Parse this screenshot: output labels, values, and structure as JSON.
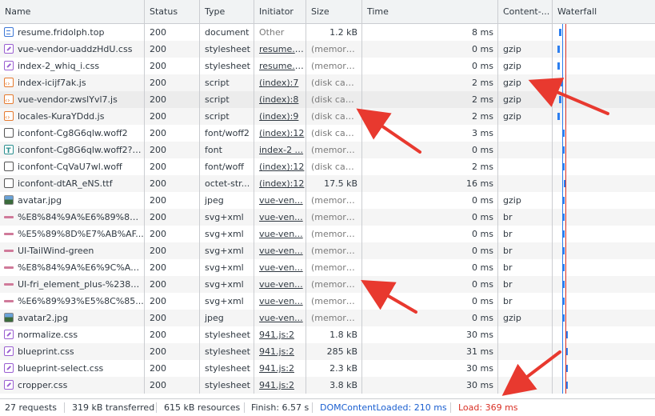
{
  "columns": {
    "name": "Name",
    "status": "Status",
    "type": "Type",
    "initiator": "Initiator",
    "size": "Size",
    "time": "Time",
    "content_encoding": "Content-...",
    "waterfall": "Waterfall"
  },
  "requests": [
    {
      "icon": "document-icon",
      "name": "resume.fridolph.top",
      "status": "200",
      "type": "document",
      "initiator": "Other",
      "size": "1.2 kB",
      "time": "8 ms",
      "encoding": ""
    },
    {
      "icon": "stylesheet-icon",
      "name": "vue-vendor-uaddzHdU.css",
      "status": "200",
      "type": "stylesheet",
      "initiator": "resume.f...",
      "size": "(memory ...",
      "time": "0 ms",
      "encoding": "gzip"
    },
    {
      "icon": "stylesheet-icon",
      "name": "index-2_whiq_i.css",
      "status": "200",
      "type": "stylesheet",
      "initiator": "resume.f...",
      "size": "(memory ...",
      "time": "0 ms",
      "encoding": "gzip"
    },
    {
      "icon": "script-icon",
      "name": "index-icijf7ak.js",
      "status": "200",
      "type": "script",
      "initiator": "(index):7",
      "size": "(disk cac...",
      "time": "2 ms",
      "encoding": "gzip"
    },
    {
      "icon": "script-icon",
      "name": "vue-vendor-zwslYvl7.js",
      "status": "200",
      "type": "script",
      "initiator": "(index):8",
      "size": "(disk cac...",
      "time": "2 ms",
      "encoding": "gzip"
    },
    {
      "icon": "script-icon",
      "name": "locales-KuraYDdd.js",
      "status": "200",
      "type": "script",
      "initiator": "(index):9",
      "size": "(disk cac...",
      "time": "2 ms",
      "encoding": "gzip"
    },
    {
      "icon": "font-file-icon",
      "name": "iconfont-Cg8G6qlw.woff2",
      "status": "200",
      "type": "font/woff2",
      "initiator": "(index):12",
      "size": "(disk cac...",
      "time": "3 ms",
      "encoding": ""
    },
    {
      "icon": "font-icon",
      "name": "iconfont-Cg8G6qlw.woff2?t...",
      "status": "200",
      "type": "font",
      "initiator": "index-2 ...",
      "size": "(memory ...",
      "time": "0 ms",
      "encoding": ""
    },
    {
      "icon": "font-file-icon",
      "name": "iconfont-CqVaU7wl.woff",
      "status": "200",
      "type": "font/woff",
      "initiator": "(index):12",
      "size": "(disk cac...",
      "time": "2 ms",
      "encoding": ""
    },
    {
      "icon": "font-file-icon",
      "name": "iconfont-dtAR_eNS.ttf",
      "status": "200",
      "type": "octet-str...",
      "initiator": "(index):12",
      "size": "17.5 kB",
      "time": "16 ms",
      "encoding": ""
    },
    {
      "icon": "image-icon",
      "name": "avatar.jpg",
      "status": "200",
      "type": "jpeg",
      "initiator": "vue-ven...",
      "size": "(memory ...",
      "time": "0 ms",
      "encoding": "gzip"
    },
    {
      "icon": "svg-icon",
      "name": "%E8%84%9A%E6%89%8B...",
      "status": "200",
      "type": "svg+xml",
      "initiator": "vue-ven...",
      "size": "(memory ...",
      "time": "0 ms",
      "encoding": "br"
    },
    {
      "icon": "svg-icon",
      "name": "%E5%89%8D%E7%AB%AF...",
      "status": "200",
      "type": "svg+xml",
      "initiator": "vue-ven...",
      "size": "(memory ...",
      "time": "0 ms",
      "encoding": "br"
    },
    {
      "icon": "svg-icon",
      "name": "UI-TailWind-green",
      "status": "200",
      "type": "svg+xml",
      "initiator": "vue-ven...",
      "size": "(memory ...",
      "time": "0 ms",
      "encoding": "br"
    },
    {
      "icon": "svg-icon",
      "name": "%E8%84%9A%E6%9C%AC...",
      "status": "200",
      "type": "svg+xml",
      "initiator": "vue-ven...",
      "size": "(memory ...",
      "time": "0 ms",
      "encoding": "br"
    },
    {
      "icon": "svg-icon",
      "name": "UI-fri_element_plus-%238a...",
      "status": "200",
      "type": "svg+xml",
      "initiator": "vue-ven...",
      "size": "(memory ...",
      "time": "0 ms",
      "encoding": "br"
    },
    {
      "icon": "svg-icon",
      "name": "%E6%89%93%E5%8C%85...",
      "status": "200",
      "type": "svg+xml",
      "initiator": "vue-ven...",
      "size": "(memory ...",
      "time": "0 ms",
      "encoding": "br"
    },
    {
      "icon": "image-icon",
      "name": "avatar2.jpg",
      "status": "200",
      "type": "jpeg",
      "initiator": "vue-ven...",
      "size": "(memory ...",
      "time": "0 ms",
      "encoding": "gzip"
    },
    {
      "icon": "stylesheet-icon",
      "name": "normalize.css",
      "status": "200",
      "type": "stylesheet",
      "initiator": "941.js:2",
      "size": "1.8 kB",
      "time": "30 ms",
      "encoding": ""
    },
    {
      "icon": "stylesheet-icon",
      "name": "blueprint.css",
      "status": "200",
      "type": "stylesheet",
      "initiator": "941.js:2",
      "size": "285 kB",
      "time": "31 ms",
      "encoding": ""
    },
    {
      "icon": "stylesheet-icon",
      "name": "blueprint-select.css",
      "status": "200",
      "type": "stylesheet",
      "initiator": "941.js:2",
      "size": "2.3 kB",
      "time": "30 ms",
      "encoding": ""
    },
    {
      "icon": "stylesheet-icon",
      "name": "cropper.css",
      "status": "200",
      "type": "stylesheet",
      "initiator": "941.js:2",
      "size": "3.8 kB",
      "time": "30 ms",
      "encoding": ""
    }
  ],
  "footer": {
    "requests": "27 requests",
    "transferred": "319 kB transferred",
    "resources": "615 kB resources",
    "finish": "Finish: 6.57 s",
    "dom_content_loaded": "DOMContentLoaded: 210 ms",
    "load": "Load: 369 ms"
  },
  "colors": {
    "dom_content_loaded": "#1a5fd0",
    "load": "#d93025",
    "annotation_arrow": "#e8392f",
    "waterfall_bar": "#2d7ff0"
  }
}
